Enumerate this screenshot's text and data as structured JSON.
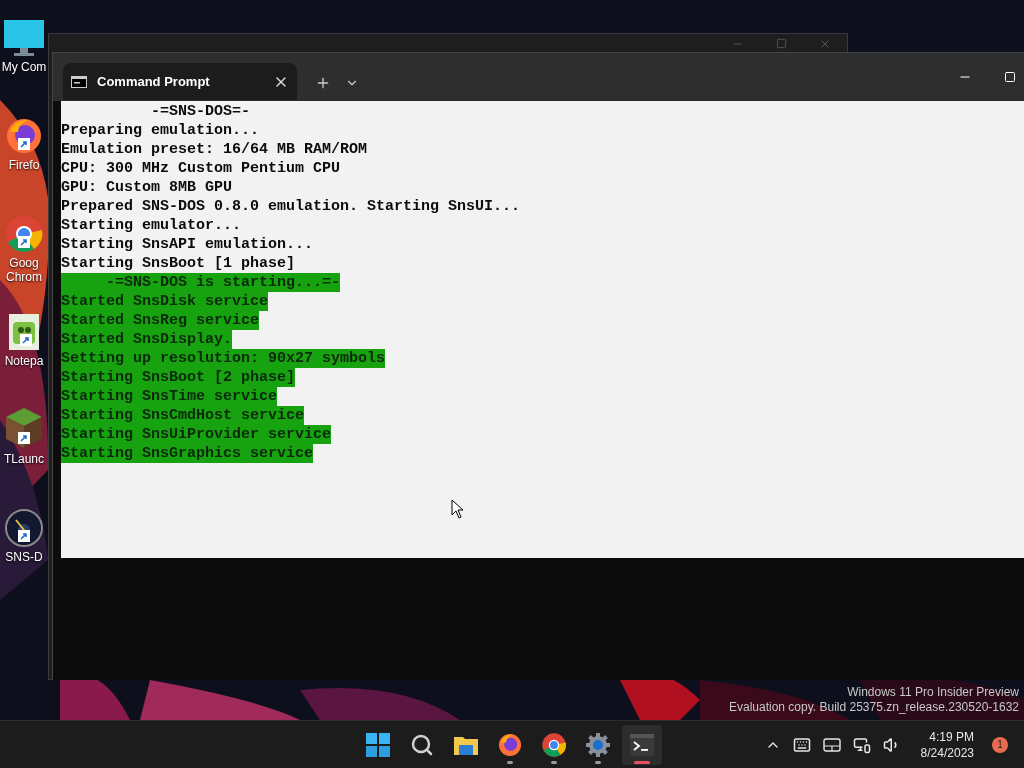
{
  "desktop": {
    "icons": [
      {
        "kind": "computer",
        "label_lines": [
          "My Com"
        ],
        "shortcut": false
      },
      {
        "kind": "firefox",
        "label_lines": [
          "Firefo"
        ],
        "shortcut": true
      },
      {
        "kind": "chrome",
        "label_lines": [
          "Goog",
          "Chrom"
        ],
        "shortcut": true
      },
      {
        "kind": "notepad",
        "label_lines": [
          "Notepa"
        ],
        "shortcut": true
      },
      {
        "kind": "block",
        "label_lines": [
          "TLaunc"
        ],
        "shortcut": true
      },
      {
        "kind": "gauge",
        "label_lines": [
          "SNS-D"
        ],
        "shortcut": true
      }
    ]
  },
  "window": {
    "tab": {
      "title": "Command Prompt"
    }
  },
  "console": {
    "lines": [
      {
        "text": "          -=SNS-DOS=-",
        "highlighted": false
      },
      {
        "text": "Preparing emulation...",
        "highlighted": false
      },
      {
        "text": "Emulation preset: 16/64 MB RAM/ROM",
        "highlighted": false
      },
      {
        "text": "CPU: 300 MHz Custom Pentium CPU",
        "highlighted": false
      },
      {
        "text": "GPU: Custom 8MB GPU",
        "highlighted": false
      },
      {
        "text": "Prepared SNS-DOS 0.8.0 emulation. Starting SnsUI...",
        "highlighted": false
      },
      {
        "text": "Starting emulator...",
        "highlighted": false
      },
      {
        "text": "Starting SnsAPI emulation...",
        "highlighted": false
      },
      {
        "text": "Starting SnsBoot [1 phase]",
        "highlighted": false
      },
      {
        "text": "     -=SNS-DOS is starting...=-",
        "highlighted": true
      },
      {
        "text": "Started SnsDisk service",
        "highlighted": true
      },
      {
        "text": "Started SnsReg service",
        "highlighted": true
      },
      {
        "text": "Started SnsDisplay.",
        "highlighted": true
      },
      {
        "text": "Setting up resolution: 90x27 symbols",
        "highlighted": true
      },
      {
        "text": "Starting SnsBoot [2 phase]",
        "highlighted": true
      },
      {
        "text": "Starting SnsTime service",
        "highlighted": true
      },
      {
        "text": "Starting SnsCmdHost service",
        "highlighted": true
      },
      {
        "text": "Starting SnsUiProvider service",
        "highlighted": true
      },
      {
        "text": "Starting SnsGraphics service",
        "highlighted": true
      }
    ]
  },
  "watermark": {
    "line_1": "Windows 11 Pro Insider Preview",
    "line_2": "Evaluation copy. Build 25375.zn_release.230520-1632"
  },
  "taskbar": {
    "apps": [
      {
        "kind": "start",
        "running": false,
        "active": false
      },
      {
        "kind": "search",
        "running": false,
        "active": false
      },
      {
        "kind": "folder",
        "running": false,
        "active": false
      },
      {
        "kind": "firefox",
        "running": true,
        "active": false
      },
      {
        "kind": "chrome",
        "running": true,
        "active": false
      },
      {
        "kind": "settings",
        "running": true,
        "active": false
      },
      {
        "kind": "terminal",
        "running": true,
        "active": true
      }
    ],
    "tray": {
      "time": "4:19 PM",
      "date": "8/24/2023",
      "notification_count": "1"
    }
  }
}
